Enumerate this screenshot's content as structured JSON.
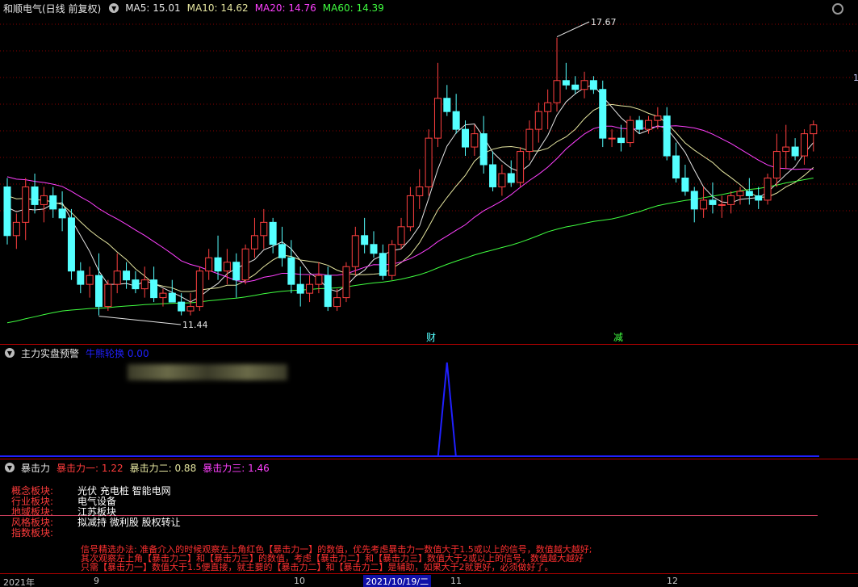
{
  "main_panel": {
    "stock_title": "和顺电气(日线 前复权)",
    "ma": [
      {
        "label": "MA5:",
        "value": "15.01",
        "color": "#e6e6e6"
      },
      {
        "label": "MA10:",
        "value": "14.62",
        "color": "#e6e6a0"
      },
      {
        "label": "MA20:",
        "value": "14.76",
        "color": "#ff40ff"
      },
      {
        "label": "MA60:",
        "value": "14.39",
        "color": "#40ff40"
      }
    ],
    "high_label": "17.67",
    "low_label": "11.44",
    "marker_cai": "财",
    "marker_jian": "减",
    "right_edge_mark": "1"
  },
  "indicator1": {
    "title": "主力实盘预警",
    "sub_label": "牛熊轮换",
    "sub_value": "0.00"
  },
  "indicator2": {
    "title": "暴击力",
    "items": [
      {
        "label": "暴击力一:",
        "value": "1.22",
        "color": "#ff3c3c"
      },
      {
        "label": "暴击力二:",
        "value": "0.88",
        "color": "#e6e6a0"
      },
      {
        "label": "暴击力三:",
        "value": "1.46",
        "color": "#ff40ff"
      }
    ]
  },
  "sectors": [
    {
      "key": "概念板块:",
      "value": "光伏 充电桩 智能电网"
    },
    {
      "key": "行业板块:",
      "value": "电气设备"
    },
    {
      "key": "地域板块:",
      "value": "江苏板块"
    },
    {
      "key": "风格板块:",
      "value": "拟减持 微利股 股权转让"
    },
    {
      "key": "指数板块:",
      "value": ""
    }
  ],
  "strategy_lines": [
    "信号精选办法: 准备介入的时候观察左上角红色【暴击力一】的数值，优先考虑暴击力一数值大于1.5或以上的信号，数值越大越好;",
    "其次观察左上角【暴击力二】和【暴击力三】的数值，考虑【暴击力二】和【暴击力三】数值大于2或以上的信号，数值越大越好",
    "只需【暴击力一】数值大于1.5便直接，就主要的【暴击力二】和【暴击力二】是辅助，如果大于2就更好，必须做好了。"
  ],
  "time_axis": {
    "labels": [
      "2021年",
      "9",
      "10",
      "11",
      "12"
    ],
    "selected": "2021/10/19/二"
  },
  "colors": {
    "up": "#ff4040",
    "down": "#54ffff",
    "ma5": "#e6e6e6",
    "ma10": "#e6e6a0",
    "ma20": "#ff40ff",
    "ma60": "#40ff40",
    "grid": "#8a0000",
    "signal": "#2020ff"
  },
  "candles": [
    [
      14.3,
      14.5,
      13.0,
      13.2
    ],
    [
      13.2,
      13.7,
      12.9,
      13.5
    ],
    [
      13.5,
      14.5,
      13.1,
      14.3
    ],
    [
      14.3,
      14.6,
      13.7,
      13.9
    ],
    [
      13.9,
      14.3,
      13.5,
      14.1
    ],
    [
      14.1,
      14.3,
      13.6,
      13.8
    ],
    [
      13.8,
      14.2,
      13.3,
      13.6
    ],
    [
      13.6,
      13.8,
      12.2,
      12.4
    ],
    [
      12.4,
      12.6,
      11.9,
      12.1
    ],
    [
      12.1,
      12.5,
      11.8,
      12.3
    ],
    [
      12.3,
      12.8,
      11.4,
      11.6
    ],
    [
      11.6,
      12.2,
      11.5,
      12.1
    ],
    [
      12.1,
      12.8,
      11.9,
      12.4
    ],
    [
      12.4,
      12.6,
      12.0,
      12.2
    ],
    [
      12.2,
      12.4,
      11.9,
      12.0
    ],
    [
      12.0,
      12.5,
      11.8,
      12.2
    ],
    [
      12.2,
      12.5,
      11.7,
      11.8
    ],
    [
      11.8,
      12.0,
      11.6,
      11.9
    ],
    [
      11.9,
      12.2,
      11.7,
      11.7
    ],
    [
      11.7,
      11.9,
      11.4,
      11.5
    ],
    [
      11.5,
      11.9,
      11.4,
      11.6
    ],
    [
      11.6,
      12.5,
      11.5,
      12.4
    ],
    [
      12.4,
      12.9,
      12.2,
      12.7
    ],
    [
      12.7,
      13.2,
      12.2,
      12.4
    ],
    [
      12.4,
      12.9,
      12.1,
      12.6
    ],
    [
      12.6,
      12.8,
      11.8,
      12.2
    ],
    [
      12.2,
      13.0,
      12.1,
      12.9
    ],
    [
      12.9,
      13.6,
      12.7,
      13.2
    ],
    [
      13.2,
      13.8,
      12.9,
      13.5
    ],
    [
      13.5,
      13.6,
      12.8,
      13.0
    ],
    [
      13.0,
      13.4,
      12.5,
      12.7
    ],
    [
      12.7,
      13.1,
      11.9,
      12.1
    ],
    [
      12.1,
      12.5,
      11.6,
      11.9
    ],
    [
      11.9,
      12.3,
      11.7,
      12.1
    ],
    [
      12.1,
      12.6,
      11.9,
      12.3
    ],
    [
      12.3,
      12.5,
      11.5,
      11.6
    ],
    [
      11.6,
      12.0,
      11.5,
      11.8
    ],
    [
      11.8,
      12.6,
      11.7,
      12.5
    ],
    [
      12.5,
      13.4,
      12.3,
      13.2
    ],
    [
      13.2,
      13.6,
      12.8,
      13.0
    ],
    [
      13.0,
      13.3,
      12.7,
      12.8
    ],
    [
      12.8,
      13.0,
      12.2,
      12.3
    ],
    [
      12.3,
      13.1,
      12.2,
      13.0
    ],
    [
      13.0,
      13.6,
      12.9,
      13.4
    ],
    [
      13.4,
      14.3,
      13.3,
      14.1
    ],
    [
      14.1,
      14.7,
      13.8,
      14.3
    ],
    [
      14.3,
      15.6,
      14.1,
      15.4
    ],
    [
      15.4,
      17.1,
      15.2,
      16.3
    ],
    [
      16.3,
      16.6,
      15.9,
      16.0
    ],
    [
      16.0,
      16.4,
      15.5,
      15.6
    ],
    [
      15.6,
      15.8,
      15.0,
      15.2
    ],
    [
      15.2,
      15.7,
      15.0,
      15.5
    ],
    [
      15.5,
      15.9,
      14.6,
      14.8
    ],
    [
      14.8,
      15.1,
      14.2,
      14.3
    ],
    [
      14.3,
      14.8,
      14.1,
      14.6
    ],
    [
      14.6,
      14.9,
      14.3,
      14.4
    ],
    [
      14.4,
      15.2,
      14.3,
      15.1
    ],
    [
      15.1,
      15.8,
      14.9,
      15.6
    ],
    [
      15.6,
      16.2,
      15.3,
      16.0
    ],
    [
      16.0,
      16.5,
      15.6,
      16.2
    ],
    [
      16.2,
      17.67,
      16.0,
      16.7
    ],
    [
      16.7,
      17.1,
      16.5,
      16.6
    ],
    [
      16.6,
      16.8,
      16.4,
      16.5
    ],
    [
      16.5,
      16.9,
      16.3,
      16.7
    ],
    [
      16.7,
      16.8,
      16.4,
      16.5
    ],
    [
      16.5,
      16.7,
      15.2,
      15.4
    ],
    [
      15.4,
      15.6,
      15.2,
      15.4
    ],
    [
      15.4,
      15.7,
      15.1,
      15.3
    ],
    [
      15.3,
      15.9,
      15.2,
      15.8
    ],
    [
      15.8,
      15.9,
      15.5,
      15.6
    ],
    [
      15.6,
      15.9,
      15.5,
      15.8
    ],
    [
      15.8,
      16.1,
      15.6,
      15.9
    ],
    [
      15.9,
      16.1,
      14.9,
      15.0
    ],
    [
      15.0,
      15.3,
      14.4,
      14.5
    ],
    [
      14.5,
      14.8,
      14.1,
      14.2
    ],
    [
      14.2,
      14.3,
      13.5,
      13.8
    ],
    [
      13.8,
      14.3,
      13.6,
      14.0
    ],
    [
      14.0,
      14.4,
      13.7,
      13.9
    ],
    [
      13.9,
      14.1,
      13.6,
      13.9
    ],
    [
      13.9,
      14.2,
      13.7,
      14.1
    ],
    [
      14.1,
      14.3,
      13.9,
      14.2
    ],
    [
      14.2,
      14.5,
      13.9,
      14.1
    ],
    [
      14.1,
      14.3,
      13.8,
      14.0
    ],
    [
      14.0,
      14.6,
      13.9,
      14.5
    ],
    [
      14.5,
      15.5,
      14.3,
      15.1
    ],
    [
      15.1,
      15.7,
      14.7,
      15.2
    ],
    [
      15.2,
      15.4,
      14.9,
      15.0
    ],
    [
      15.0,
      15.6,
      14.8,
      15.5
    ],
    [
      15.5,
      15.8,
      15.1,
      15.7
    ]
  ],
  "signal_peak_index": 48
}
